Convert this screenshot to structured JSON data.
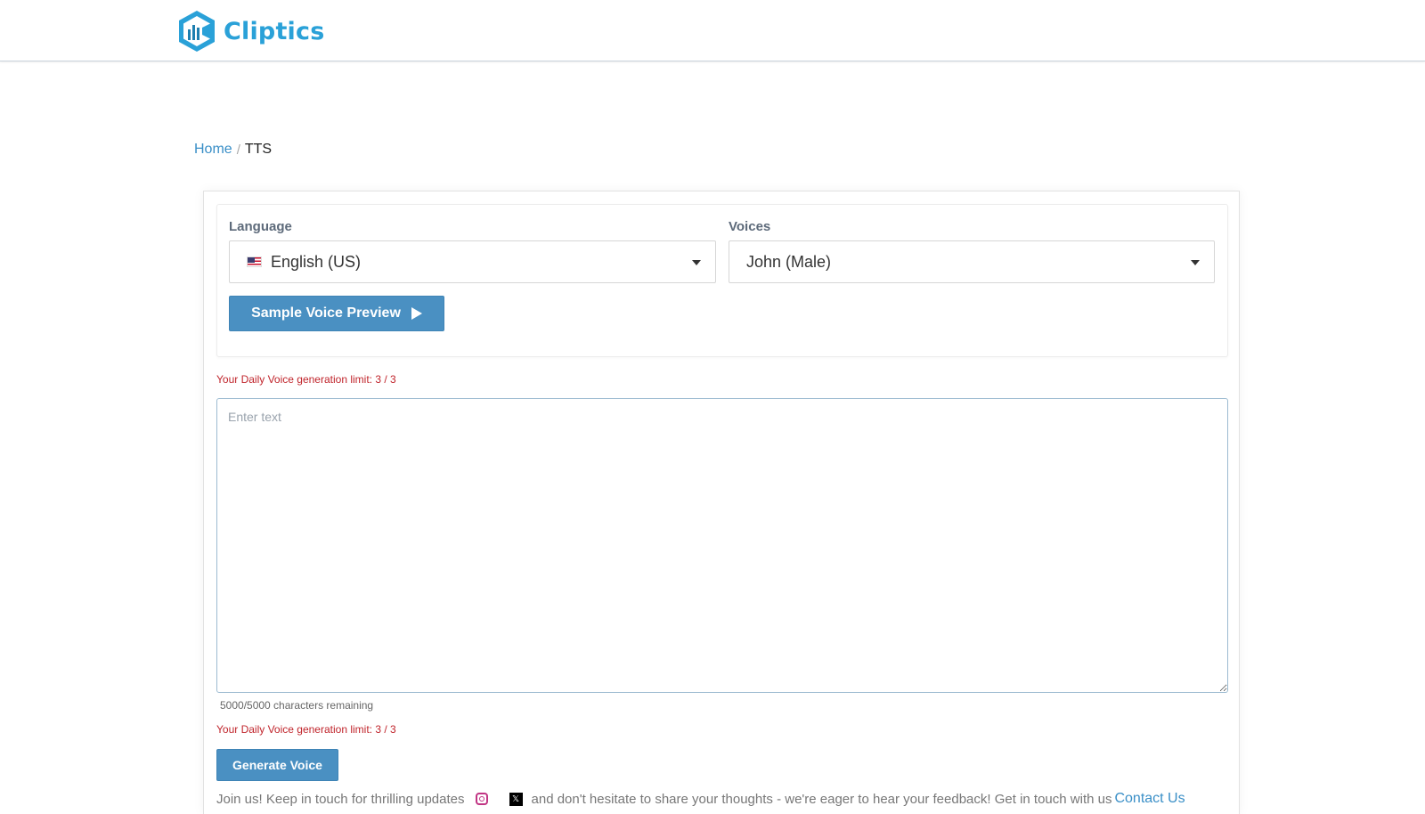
{
  "brand": {
    "name": "Cliptics",
    "icon": "cliptics-logo-icon",
    "color": "#2aa1d8"
  },
  "breadcrumb": {
    "home": "Home",
    "separator": "/",
    "current": "TTS"
  },
  "language": {
    "label": "Language",
    "selected": "English (US)",
    "flag_icon": "us-flag-icon"
  },
  "voices": {
    "label": "Voices",
    "selected": "John (Male)"
  },
  "sample_button": {
    "label": "Sample Voice Preview",
    "icon": "play-icon"
  },
  "limit_text": "Your Daily Voice generation limit: 3 / 3",
  "editor": {
    "placeholder": "Enter text",
    "value": "",
    "chars_remaining": "5000/5000 characters remaining"
  },
  "generate_button": {
    "label": "Generate Voice"
  },
  "footer": {
    "text_before": "Join us! Keep in touch for thrilling updates",
    "text_after": "and don't hesitate to share your thoughts - we're eager to hear your feedback! Get in touch with us",
    "contact_link": "Contact Us",
    "icons": [
      "instagram-icon",
      "x-icon"
    ]
  },
  "colors": {
    "primary_button": "#4a90c2",
    "limit_text": "#c0242b",
    "link": "#3a8fc7"
  }
}
